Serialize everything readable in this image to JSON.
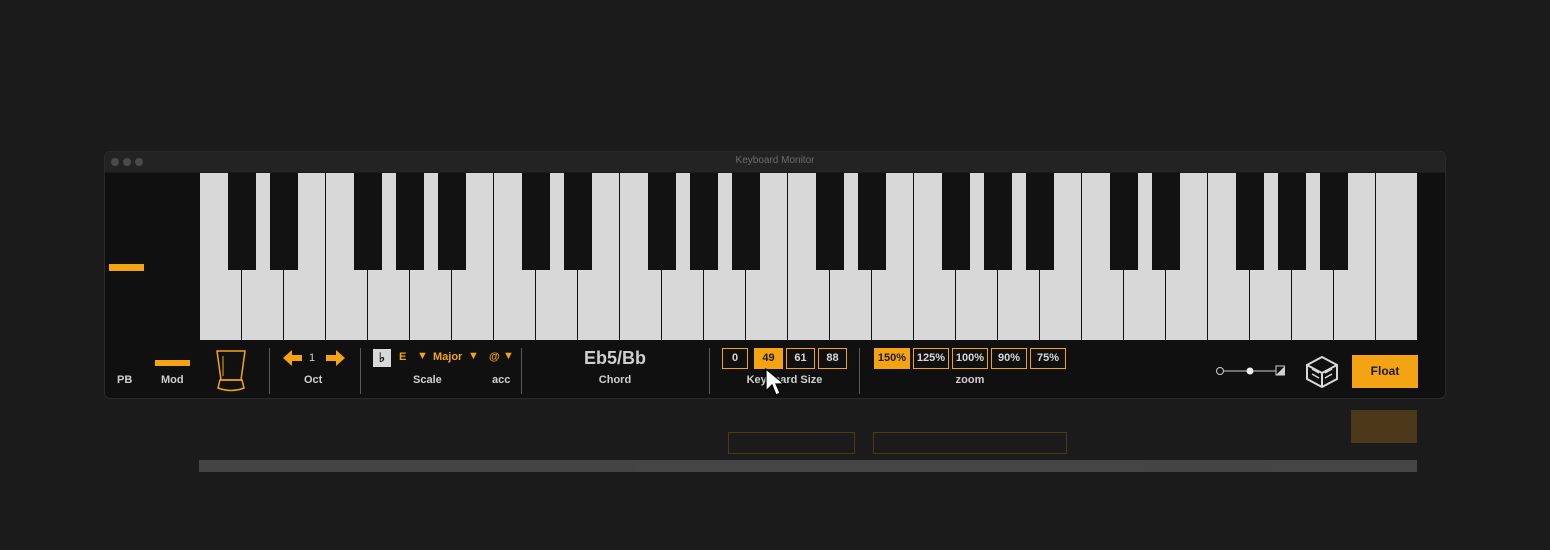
{
  "window": {
    "title": "Keyboard Monitor"
  },
  "controls": {
    "pb_label": "PB",
    "mod_label": "Mod",
    "oct_value": "1",
    "oct_label": "Oct",
    "scale_root": "E",
    "scale_mode": "Major",
    "scale_label": "Scale",
    "acc_value": "@",
    "acc_label": "acc",
    "chord_value": "Eb5/Bb",
    "chord_label": "Chord",
    "keyboard_size_label": "Keyboard Size",
    "keyboard_sizes": [
      "0",
      "49",
      "61",
      "88"
    ],
    "keyboard_size_selected": "49",
    "zoom_label": "zoom",
    "zoom_levels": [
      "150%",
      "125%",
      "100%",
      "90%",
      "75%"
    ],
    "zoom_selected": "150%",
    "float_label": "Float"
  },
  "colors": {
    "accent": "#f4a413",
    "background": "#1b1b1b",
    "white_key": "#d8d8d8",
    "black_key": "#121212"
  }
}
